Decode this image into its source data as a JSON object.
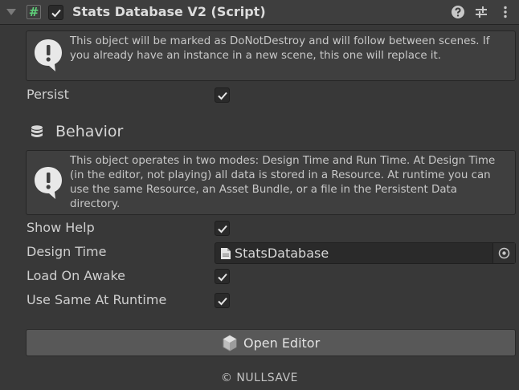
{
  "header": {
    "title": "Stats Database V2 (Script)",
    "enabled": true,
    "script_icon_glyph": "#",
    "icons": [
      "help-icon",
      "preset-icon",
      "kebab-menu-icon"
    ]
  },
  "persist_help": {
    "message": "This object will be marked as DoNotDestroy and will follow between scenes. If you already have an instance in a new scene, this one will replace it."
  },
  "persist": {
    "label": "Persist",
    "checked": true
  },
  "behavior": {
    "title": "Behavior",
    "help": "This object operates in two modes: Design Time and Run Time. At Design Time (in the editor, not playing) all data is stored in a Resource. At runtime you can use the same Resource, an Asset Bundle, or a file in the Persistent Data directory."
  },
  "fields": {
    "show_help": {
      "label": "Show Help",
      "checked": true
    },
    "design_time": {
      "label": "Design Time",
      "value": "StatsDatabase"
    },
    "load_on_awake": {
      "label": "Load On Awake",
      "checked": true
    },
    "use_same_at_runtime": {
      "label": "Use Same At Runtime",
      "checked": true
    }
  },
  "open_editor": {
    "label": "Open Editor"
  },
  "footer": {
    "text": "© NULLSAVE"
  },
  "colors": {
    "background": "#383838",
    "header": "#3e3e3e",
    "button": "#585858",
    "script_icon": "#5fd17a"
  }
}
